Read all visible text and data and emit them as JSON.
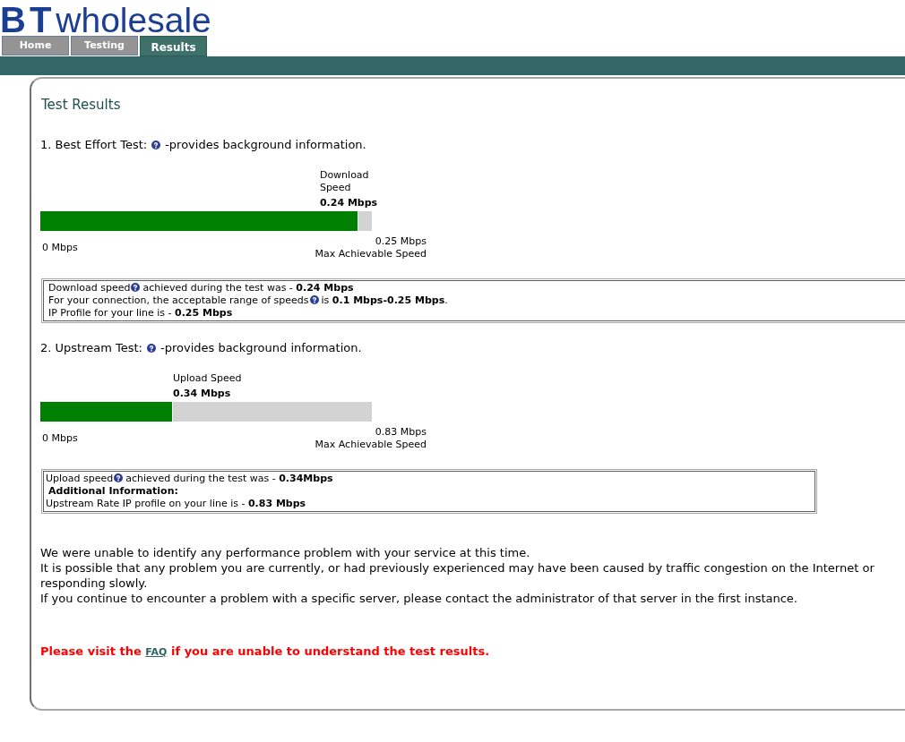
{
  "logo": {
    "mark": "BT",
    "text": "wholesale"
  },
  "tabs": [
    {
      "label": "Home",
      "selected": false
    },
    {
      "label": "Testing",
      "selected": false
    },
    {
      "label": "Results",
      "selected": true
    }
  ],
  "panel": {
    "title": "Test Results",
    "tests": [
      {
        "heading": [
          "1. Best Effort Test:",
          "-provides background information."
        ],
        "meter": {
          "label": "Download Speed",
          "reading": "0.24 Mbps",
          "level": 0.96,
          "min_label": "0 Mbps",
          "max_reading": "0.25 Mbps",
          "max_label": "Max Achievable Speed"
        },
        "details": [
          {
            "kind": "text",
            "parts": [
              "Download speed",
              "achieved during the test was - **0.24 Mbps**"
            ]
          },
          {
            "kind": "text",
            "parts": [
              "For your connection, the acceptable range of speeds",
              "is **0.1 Mbps-0.25 Mbps**."
            ]
          },
          {
            "kind": "text",
            "parts": [
              "IP Profile for your line is - **0.25 Mbps**"
            ]
          }
        ]
      },
      {
        "heading": [
          "2. Upstream Test:",
          "-provides background information."
        ],
        "meter": {
          "label": "Upload Speed",
          "reading": "0.34 Mbps",
          "level": 0.4,
          "min_label": "0 Mbps",
          "max_reading": "0.83 Mbps",
          "max_label": "Max Achievable Speed"
        },
        "details": [
          {
            "kind": "text",
            "parts": [
              "Upload speed",
              "achieved during the test was - **0.34Mbps**"
            ]
          },
          {
            "kind": "heading",
            "parts": [
              "Additional Information:"
            ]
          },
          {
            "kind": "text",
            "parts": [
              "Upstream Rate IP profile on your line is - **0.83 Mbps**"
            ]
          }
        ]
      }
    ],
    "message": [
      "We were unable to identify any performance problem with your service at this time.",
      "It is possible that any problem you are currently, or had previously experienced may have been caused by traffic congestion on the Internet or",
      "responding slowly.",
      "If you continue to encounter a problem with a specific server, please contact the administrator of that server in the first instance."
    ],
    "notice": {
      "before": "Please visit the",
      "link": "FAQ",
      "after": "if you are unable to understand the test results."
    }
  }
}
